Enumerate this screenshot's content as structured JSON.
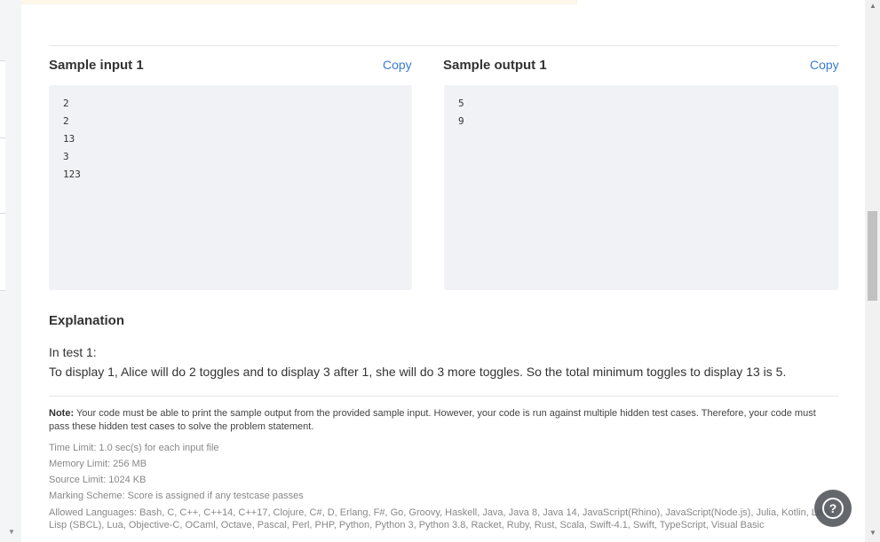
{
  "sample_input": {
    "title": "Sample input 1",
    "copy_label": "Copy",
    "lines": [
      "2",
      "2",
      "13",
      "3",
      "123"
    ]
  },
  "sample_output": {
    "title": "Sample output 1",
    "copy_label": "Copy",
    "lines": [
      "5",
      "9"
    ]
  },
  "explanation": {
    "heading": "Explanation",
    "line1": "In test 1:",
    "line2": "To display 1, Alice will do 2 toggles and to display 3 after 1, she will do 3 more toggles. So the total minimum toggles to display 13 is 5."
  },
  "note": {
    "label": "Note:",
    "text": "Your code must be able to print the sample output from the provided sample input. However, your code is run against multiple hidden test cases. Therefore, your code must pass these hidden test cases to solve the problem statement."
  },
  "limits": {
    "time": "Time Limit: 1.0 sec(s) for each input file",
    "memory": "Memory Limit: 256 MB",
    "source": "Source Limit: 1024 KB",
    "marking": "Marking Scheme: Score is assigned if any testcase passes",
    "languages": "Allowed Languages: Bash, C, C++, C++14, C++17, Clojure, C#, D, Erlang, F#, Go, Groovy, Haskell, Java, Java 8, Java 14, JavaScript(Rhino), JavaScript(Node.js), Julia, Kotlin, Lisp, Lisp (SBCL), Lua, Objective-C, OCaml, Octave, Pascal, Perl, PHP, Python, Python 3, Python 3.8, Racket, Ruby, Rust, Scala, Swift-4.1, Swift, TypeScript, Visual Basic"
  },
  "help": {
    "glyph": "?"
  },
  "icons": {
    "help": "question-circle-icon",
    "scroll_up": "triangle-up-icon",
    "scroll_down": "triangle-down-icon"
  }
}
